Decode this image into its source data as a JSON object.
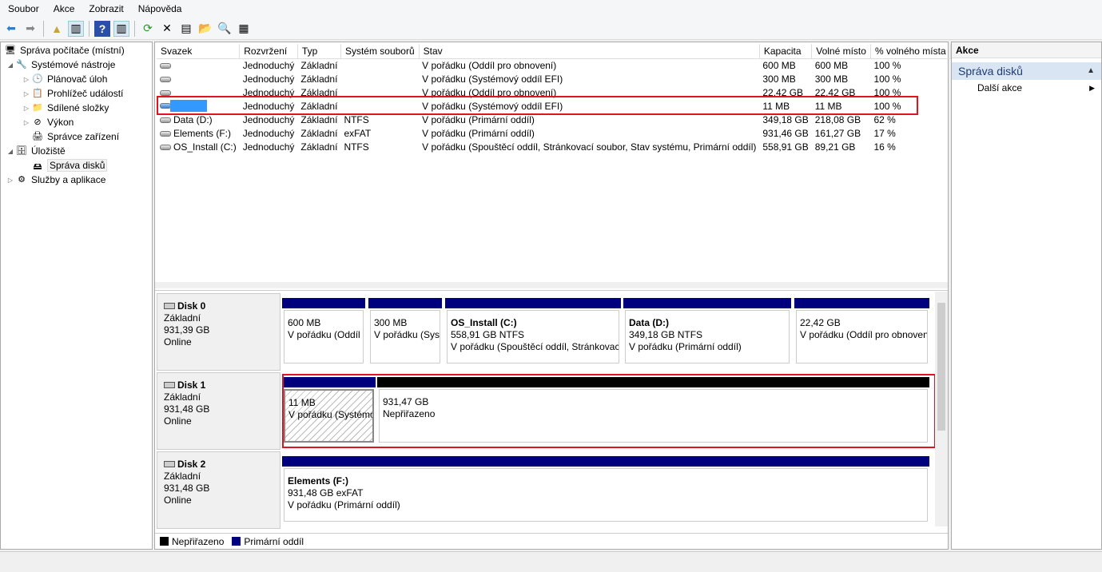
{
  "menu": [
    "Soubor",
    "Akce",
    "Zobrazit",
    "Nápověda"
  ],
  "tree": {
    "root": "Správa počítače (místní)",
    "system_tools": "Systémové nástroje",
    "task_scheduler": "Plánovač úloh",
    "event_viewer": "Prohlížeč událostí",
    "shared_folders": "Sdílené složky",
    "performance": "Výkon",
    "device_manager": "Správce zařízení",
    "storage": "Úložiště",
    "disk_management": "Správa disků",
    "services": "Služby a aplikace"
  },
  "table": {
    "headers": [
      "Svazek",
      "Rozvržení",
      "Typ",
      "Systém souborů",
      "Stav",
      "Kapacita",
      "Volné místo",
      "% volného místa"
    ],
    "rows": [
      [
        "",
        "Jednoduchý",
        "Základní",
        "",
        "V pořádku (Oddíl pro obnovení)",
        "600 MB",
        "600 MB",
        "100 %"
      ],
      [
        "",
        "Jednoduchý",
        "Základní",
        "",
        "V pořádku (Systémový oddíl EFI)",
        "300 MB",
        "300 MB",
        "100 %"
      ],
      [
        "",
        "Jednoduchý",
        "Základní",
        "",
        "V pořádku (Oddíl pro obnovení)",
        "22,42 GB",
        "22,42 GB",
        "100 %"
      ],
      [
        "",
        "Jednoduchý",
        "Základní",
        "",
        "V pořádku (Systémový oddíl EFI)",
        "11 MB",
        "11 MB",
        "100 %"
      ],
      [
        "Data (D:)",
        "Jednoduchý",
        "Základní",
        "NTFS",
        "V pořádku (Primární oddíl)",
        "349,18 GB",
        "218,08 GB",
        "62 %"
      ],
      [
        "Elements (F:)",
        "Jednoduchý",
        "Základní",
        "exFAT",
        "V pořádku (Primární oddíl)",
        "931,46 GB",
        "161,27 GB",
        "17 %"
      ],
      [
        "OS_Install (C:)",
        "Jednoduchý",
        "Základní",
        "NTFS",
        "V pořádku (Spouštěcí oddíl, Stránkovací soubor, Stav systému, Primární oddíl)",
        "558,91 GB",
        "89,21 GB",
        "16 %"
      ]
    ]
  },
  "disks": [
    {
      "name": "Disk 0",
      "type": "Základní",
      "size": "931,39 GB",
      "status": "Online",
      "parts": [
        {
          "title": "",
          "size": "600 MB",
          "state": "V pořádku (Oddíl pro obnovení)"
        },
        {
          "title": "",
          "size": "300 MB",
          "state": "V pořádku (Systémový oddíl EFI)"
        },
        {
          "title": "OS_Install  (C:)",
          "size": "558,91 GB NTFS",
          "state": "V pořádku (Spouštěcí oddíl, Stránkovací soubor)"
        },
        {
          "title": "Data  (D:)",
          "size": "349,18 GB NTFS",
          "state": "V pořádku (Primární oddíl)"
        },
        {
          "title": "",
          "size": "22,42 GB",
          "state": "V pořádku (Oddíl pro obnovení)"
        }
      ]
    },
    {
      "name": "Disk 1",
      "type": "Základní",
      "size": "931,48 GB",
      "status": "Online",
      "parts": [
        {
          "title": "",
          "size": "11 MB",
          "state": "V pořádku (Systémový oddíl EFI)"
        },
        {
          "title": "",
          "size": "931,47 GB",
          "state": "Nepřiřazeno"
        }
      ]
    },
    {
      "name": "Disk 2",
      "type": "Základní",
      "size": "931,48 GB",
      "status": "Online",
      "parts": [
        {
          "title": "Elements  (F:)",
          "size": "931,48 GB exFAT",
          "state": "V pořádku (Primární oddíl)"
        }
      ]
    }
  ],
  "legend": {
    "unallocated": "Nepřiřazeno",
    "primary": "Primární oddíl"
  },
  "actions": {
    "header": "Akce",
    "section": "Správa disků",
    "more": "Další akce"
  },
  "colors": {
    "primary": "#00007f",
    "unallocated": "#000000",
    "highlight": "#e0141e"
  }
}
